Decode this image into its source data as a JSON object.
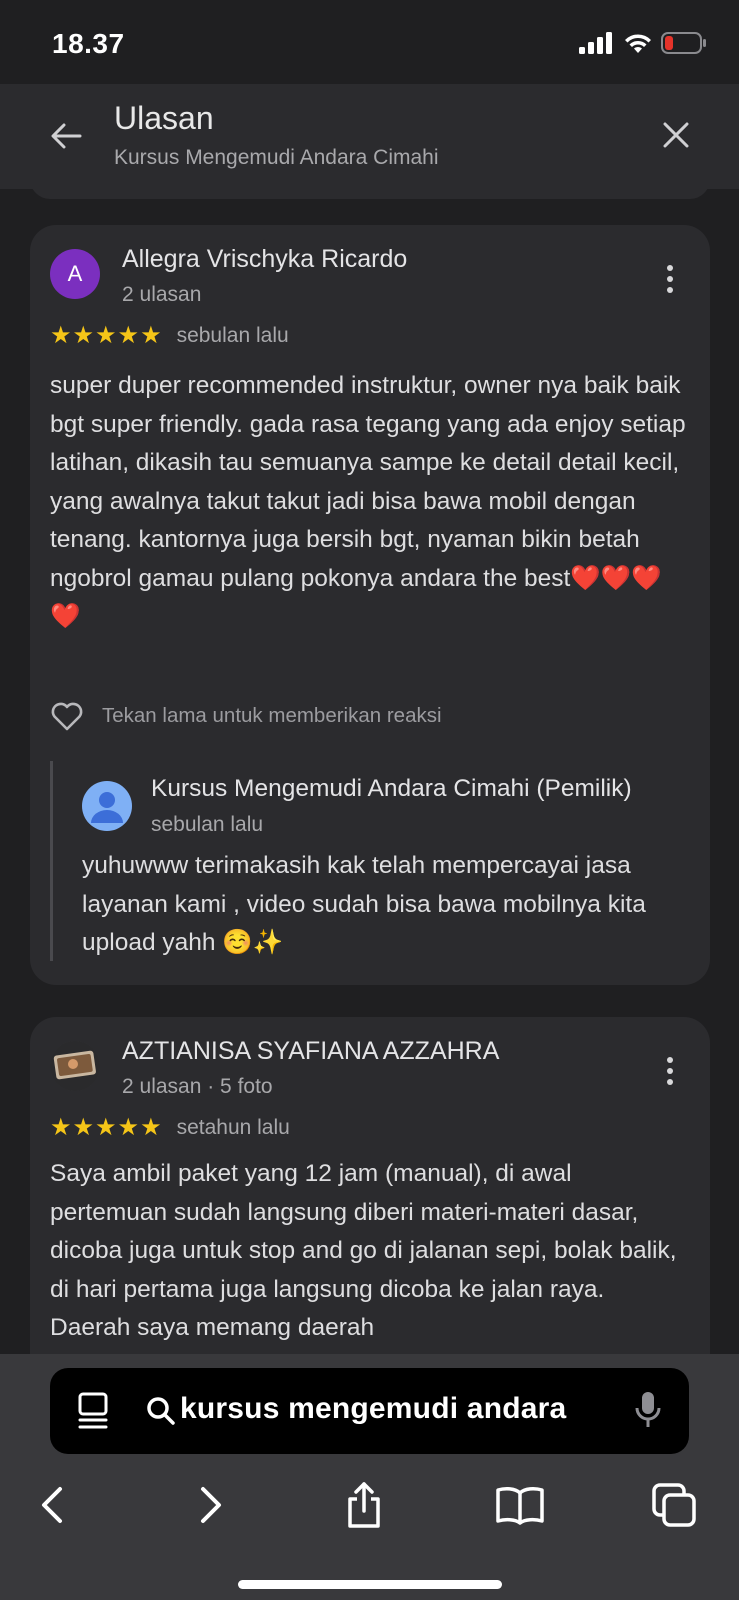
{
  "status_bar": {
    "time": "18.37"
  },
  "header": {
    "title": "Ulasan",
    "subtitle": "Kursus Mengemudi Andara Cimahi"
  },
  "reviews": [
    {
      "avatar_letter": "A",
      "name": "Allegra Vrischyka Ricardo",
      "meta": "2 ulasan",
      "stars": "★★★★★",
      "rating": 5,
      "time": "sebulan lalu",
      "text": "super duper recommended instruktur, owner nya baik baik bgt super friendly. gada rasa tegang yang ada enjoy setiap latihan, dikasih tau semuanya sampe ke detail detail kecil, yang awalnya takut takut jadi bisa bawa mobil dengan tenang. kantornya juga bersih bgt, nyaman bikin betah ngobrol gamau pulang pokonya andara the best❤️❤️❤️❤️",
      "reaction_hint": "Tekan lama untuk memberikan reaksi",
      "owner_reply": {
        "name": "Kursus Mengemudi Andara Cimahi (Pemilik)",
        "time": "sebulan lalu",
        "text": "yuhuwww terimakasih kak telah mempercayai jasa layanan kami , video sudah bisa bawa mobilnya kita upload yahh ☺️✨"
      }
    },
    {
      "name": "AZTIANISA SYAFIANA AZZAHRA",
      "meta": "2 ulasan · 5 foto",
      "stars": "★★★★★",
      "rating": 5,
      "time": "setahun lalu",
      "text": "Saya ambil paket yang 12 jam (manual), di awal pertemuan sudah langsung diberi materi-materi dasar, dicoba juga untuk stop and go di jalanan sepi, bolak balik, di hari pertama juga langsung dicoba ke jalan raya. Daerah saya memang daerah"
    }
  ],
  "browser": {
    "search_text": "kursus mengemudi andara"
  },
  "icons": {
    "back": "arrow-left-icon",
    "close": "close-icon",
    "more": "more-vertical-icon",
    "heart": "heart-outline-icon",
    "tabs": "tabs-list-icon",
    "search": "search-icon",
    "mic": "microphone-icon",
    "nav_back": "chevron-left-icon",
    "nav_forward": "chevron-right-icon",
    "share": "share-icon",
    "bookmarks": "book-icon",
    "tab_switcher": "tabs-icon"
  },
  "colors": {
    "star": "#f5c518",
    "avatar_a": "#7b2fbf",
    "background": "#1f1f21",
    "card": "#2b2b2e"
  }
}
